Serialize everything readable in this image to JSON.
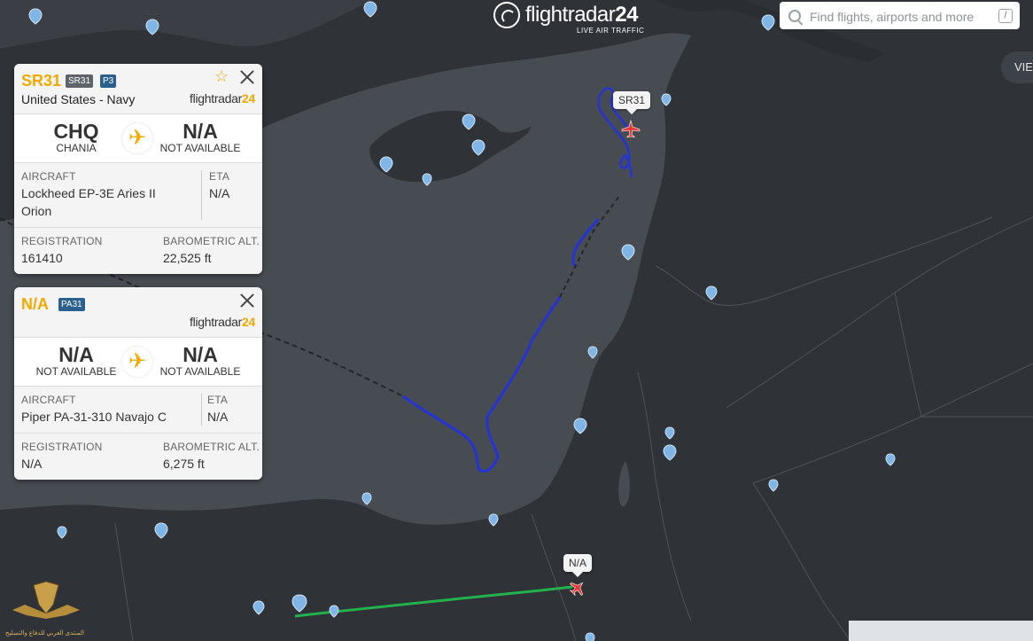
{
  "header": {
    "brand": "flightradar24",
    "brand_light": "flightradar",
    "brand_bold": "24",
    "tagline": "LIVE AIR TRAFFIC",
    "search_placeholder": "Find flights, airports and more",
    "search_shortcut": "/",
    "view_button": "VIEW"
  },
  "flights": [
    {
      "callsign": "SR31",
      "badges": [
        "SR31",
        "P3"
      ],
      "operator": "United States - Navy",
      "brand_light": "flightradar",
      "brand_bold": "24",
      "from_code": "CHQ",
      "from_name": "CHANIA",
      "to_code": "N/A",
      "to_name": "NOT AVAILABLE",
      "aircraft_label": "AIRCRAFT",
      "aircraft_line1": "Lockheed EP-3E Aries II",
      "aircraft_line2": "Orion",
      "eta_label": "ETA",
      "eta": "N/A",
      "registration_label": "REGISTRATION",
      "registration": "161410",
      "altitude_label": "BAROMETRIC ALT.",
      "altitude": "22,525 ft",
      "map_label": "SR31"
    },
    {
      "callsign": "N/A",
      "badges": [
        "PA31"
      ],
      "operator": "",
      "brand_light": "flightradar",
      "brand_bold": "24",
      "from_code": "N/A",
      "from_name": "NOT AVAILABLE",
      "to_code": "N/A",
      "to_name": "NOT AVAILABLE",
      "aircraft_label": "AIRCRAFT",
      "aircraft_line1": "Piper PA-31-310 Navajo C",
      "aircraft_line2": "",
      "eta_label": "ETA",
      "eta": "N/A",
      "registration_label": "REGISTRATION",
      "registration": "N/A",
      "altitude_label": "BAROMETRIC ALT.",
      "altitude": "6,275 ft",
      "map_label": "N/A"
    }
  ],
  "colors": {
    "land": "#2f3237",
    "sea": "#474c53",
    "track_sr31": "#2433d6",
    "track_pa31": "#22b14c",
    "accent": "#f2a900",
    "airport_pin": "#7fb6e6"
  },
  "watermark": "المنتدى العربي للدفاع والتسليح"
}
